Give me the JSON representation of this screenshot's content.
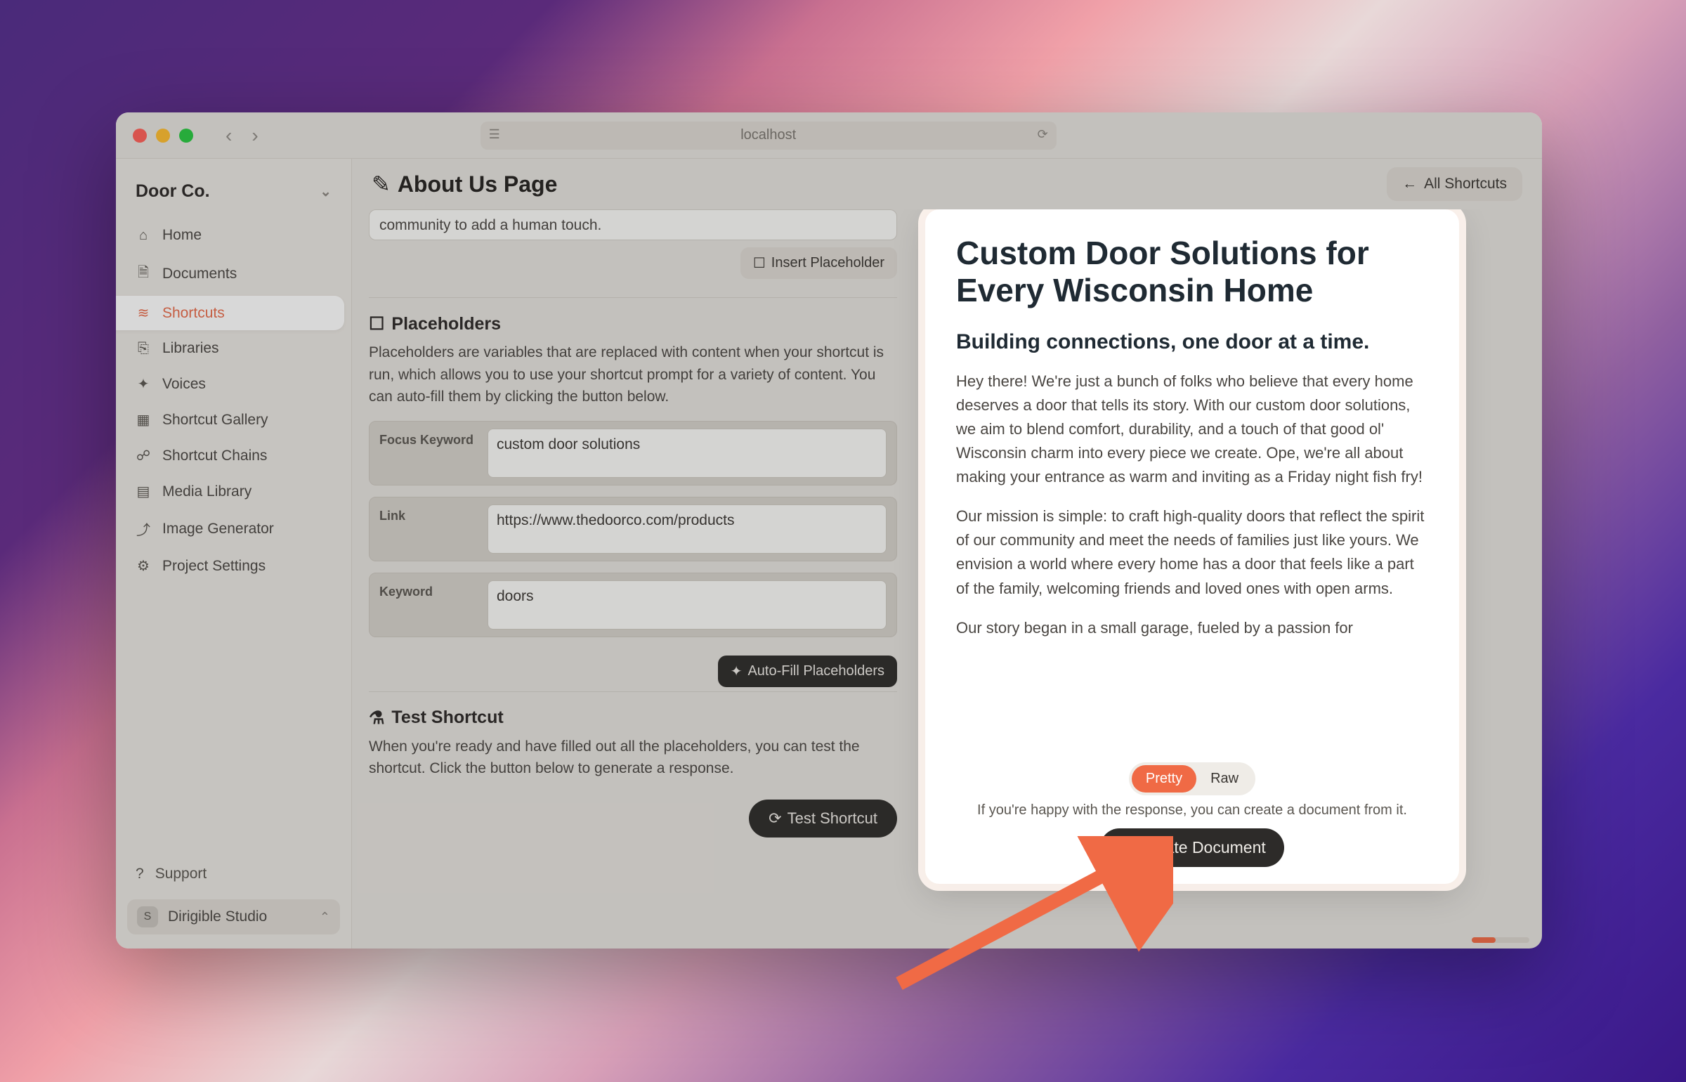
{
  "browser": {
    "address": "localhost"
  },
  "workspace": {
    "name": "Door Co."
  },
  "sidebar": {
    "items": [
      {
        "label": "Home"
      },
      {
        "label": "Documents"
      },
      {
        "label": "Shortcuts"
      },
      {
        "label": "Libraries"
      },
      {
        "label": "Voices"
      },
      {
        "label": "Shortcut Gallery"
      },
      {
        "label": "Shortcut Chains"
      },
      {
        "label": "Media Library"
      },
      {
        "label": "Image Generator"
      },
      {
        "label": "Project Settings"
      }
    ],
    "support_label": "Support"
  },
  "account": {
    "initial": "S",
    "name": "Dirigible Studio"
  },
  "header": {
    "title": "About Us Page",
    "all_shortcuts_label": "All Shortcuts"
  },
  "form": {
    "prompt_tail": "community to add a human touch.",
    "insert_placeholder_label": "Insert Placeholder",
    "placeholders_heading": "Placeholders",
    "placeholders_desc": "Placeholders are variables that are replaced with content when your shortcut is run, which allows you to use your shortcut prompt for a variety of content. You can auto-fill them by clicking the button below.",
    "fields": [
      {
        "label": "Focus Keyword",
        "value": "custom door solutions"
      },
      {
        "label": "Link",
        "value": "https://www.thedoorco.com/products"
      },
      {
        "label": "Keyword",
        "value": "doors"
      }
    ],
    "autofill_label": "Auto-Fill Placeholders",
    "test_heading": "Test Shortcut",
    "test_desc": "When you're ready and have filled out all the placeholders, you can test the shortcut. Click the button below to generate a response.",
    "test_button_label": "Test Shortcut"
  },
  "preview": {
    "title": "Custom Door Solutions for Every Wisconsin Home",
    "subtitle": "Building connections, one door at a time.",
    "p1": "Hey there! We're just a bunch of folks who believe that every home deserves a door that tells its story. With our custom door solutions, we aim to blend comfort, durability, and a touch of that good ol' Wisconsin charm into every piece we create. Ope, we're all about making your entrance as warm and inviting as a Friday night fish fry!",
    "p2": "Our mission is simple: to craft high-quality doors that reflect the spirit of our community and meet the needs of families just like yours. We envision a world where every home has a door that feels like a part of the family, welcoming friends and loved ones with open arms.",
    "p3": "Our story began in a small garage, fueled by a passion for",
    "toggle_pretty": "Pretty",
    "toggle_raw": "Raw",
    "happy_text": "If you're happy with the response, you can create a document from it.",
    "create_label": "Create Document"
  }
}
